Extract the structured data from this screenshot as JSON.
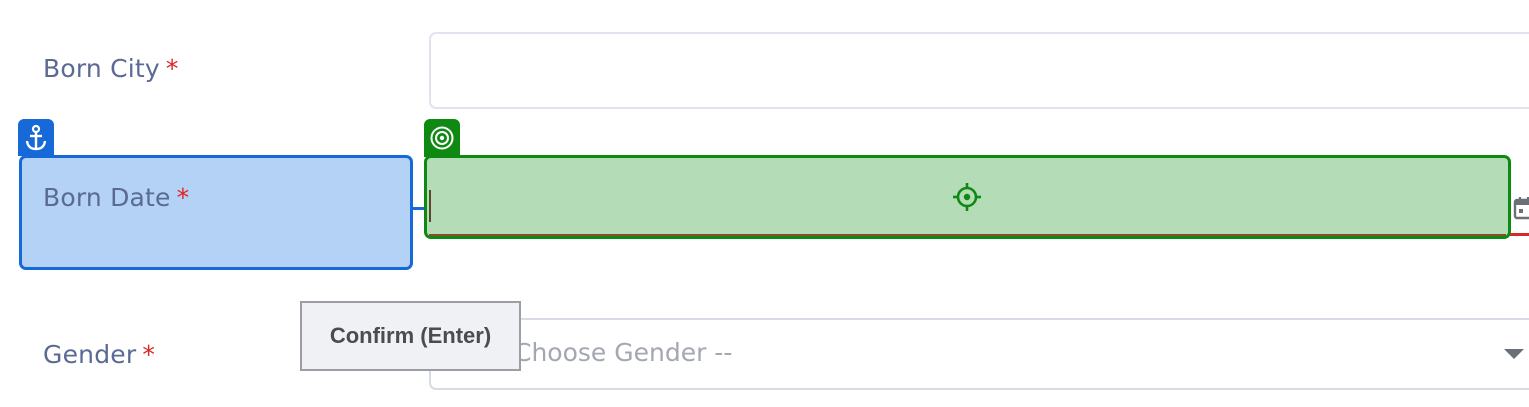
{
  "fields": {
    "born_city": {
      "label": "Born City",
      "required_marker": "*",
      "value": ""
    },
    "born_date": {
      "label": "Born Date",
      "required_marker": "*",
      "value": ""
    },
    "gender": {
      "label": "Gender",
      "required_marker": "*",
      "placeholder": "-- Choose Gender --"
    }
  },
  "overlay": {
    "anchor_icon": "anchor-icon",
    "target_icon": "target-icon",
    "crosshair_icon": "crosshair-icon",
    "anchor_color": "#1769d8",
    "target_color": "#0e8a13",
    "tooltip": "Confirm (Enter)"
  },
  "icons": {
    "calendar": "calendar-icon",
    "dropdown": "chevron-down-icon"
  },
  "colors": {
    "label": "#5a6a93",
    "required": "#e02424",
    "error": "#d62828"
  }
}
